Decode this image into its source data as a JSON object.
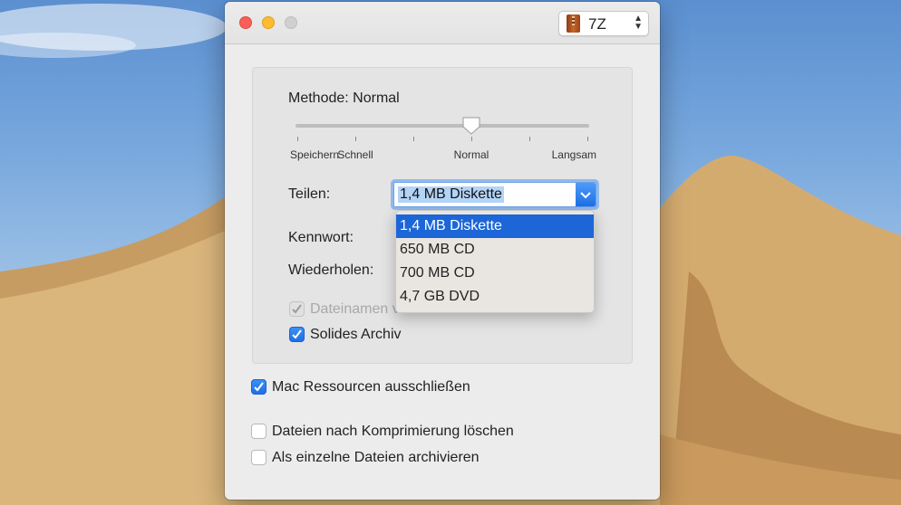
{
  "window": {
    "format_select": {
      "value": "7Z"
    }
  },
  "method": {
    "label": "Methode: Normal",
    "slider_level": 0.6,
    "ticks": [
      "Speichern",
      "Schnell",
      "",
      "Normal",
      "",
      "Langsam"
    ]
  },
  "split": {
    "label": "Teilen:",
    "value": "1,4 MB Diskette",
    "options": [
      "1,4 MB Diskette",
      "650 MB CD",
      "700 MB CD",
      "4,7 GB DVD"
    ],
    "selected_index": 0
  },
  "password": {
    "label": "Kennwort:"
  },
  "repeat": {
    "label": "Wiederholen:"
  },
  "checkboxes": {
    "encrypt_names": {
      "label": "Dateinamen verschlüsseln",
      "checked": true,
      "disabled": true
    },
    "solid_archive": {
      "label": "Solides Archiv",
      "checked": true
    },
    "exclude_mac": {
      "label": "Mac Ressourcen ausschließen",
      "checked": true
    },
    "delete_after": {
      "label": "Dateien nach Komprimierung löschen",
      "checked": false
    },
    "separate": {
      "label": "Als einzelne Dateien archivieren",
      "checked": false
    }
  },
  "colors": {
    "accent": "#1c66d8",
    "close": "#fc5f57",
    "minimize": "#fdbc2e"
  }
}
